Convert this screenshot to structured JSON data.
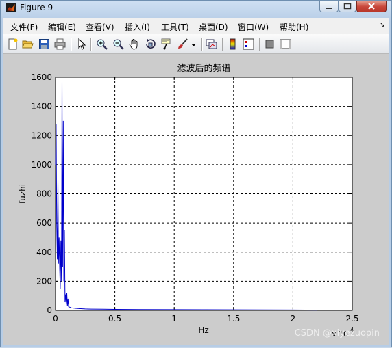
{
  "window": {
    "title": "Figure 9"
  },
  "menu": [
    "文件(F)",
    "编辑(E)",
    "查看(V)",
    "插入(I)",
    "工具(T)",
    "桌面(D)",
    "窗口(W)",
    "帮助(H)"
  ],
  "menu_overflow_glyph": "↘",
  "toolbar": [
    "new-figure-icon",
    "open-file-icon",
    "save-icon",
    "print-icon",
    "pointer-icon",
    "zoom-in-icon",
    "zoom-out-icon",
    "pan-hand-icon",
    "rotate-3d-icon",
    "data-cursor-icon",
    "brush-icon",
    "brush-dropdown-icon",
    "link-plot-icon",
    "colorbar-icon",
    "legend-icon",
    "hide-plot-tools-icon",
    "show-plot-tools-icon"
  ],
  "chart_data": {
    "type": "line",
    "title": "滤波后的频谱",
    "xlabel": "Hz",
    "ylabel": "fuzhi",
    "x_exponent_label": "x 10",
    "x_exponent_power": "4",
    "xlim": [
      0,
      2.5
    ],
    "ylim": [
      0,
      1600
    ],
    "xticks": [
      "0",
      "0.5",
      "1",
      "1.5",
      "2",
      "2.5"
    ],
    "yticks": [
      "0",
      "200",
      "400",
      "600",
      "800",
      "1000",
      "1200",
      "1400",
      "1600"
    ],
    "grid": true,
    "series": [
      {
        "color": "#0000cc",
        "x": [
          0,
          0.005,
          0.01,
          0.015,
          0.02,
          0.025,
          0.03,
          0.035,
          0.04,
          0.045,
          0.05,
          0.055,
          0.06,
          0.065,
          0.07,
          0.075,
          0.08,
          0.085,
          0.09,
          0.095,
          0.1,
          0.105,
          0.11,
          0.12,
          0.13,
          0.15,
          0.17,
          0.2,
          0.25,
          0.3,
          0.4,
          0.5,
          0.7,
          1.0,
          1.5,
          2.0,
          2.2
        ],
        "y": [
          1000,
          1280,
          600,
          350,
          900,
          320,
          500,
          280,
          150,
          480,
          200,
          1570,
          300,
          1300,
          200,
          550,
          60,
          110,
          40,
          120,
          30,
          80,
          25,
          22,
          18,
          16,
          14,
          12,
          10,
          9,
          8,
          7,
          6,
          5,
          4,
          3,
          2
        ]
      }
    ]
  },
  "watermark": "CSDN @xiyezuopin"
}
